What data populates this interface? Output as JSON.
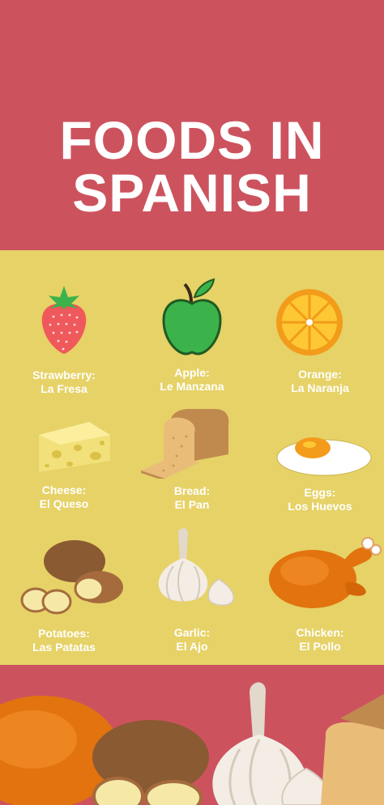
{
  "title": {
    "line1": "FOODS IN",
    "line2": "SPANISH"
  },
  "colors": {
    "header_bg": "#cc535e",
    "panel_bg": "#e6d267",
    "text": "#ffffff"
  },
  "items": [
    {
      "icon": "strawberry-icon",
      "english": "Strawberry:",
      "spanish": "La Fresa"
    },
    {
      "icon": "apple-icon",
      "english": "Apple:",
      "spanish": "Le Manzana"
    },
    {
      "icon": "orange-icon",
      "english": "Orange:",
      "spanish": "La Naranja"
    },
    {
      "icon": "cheese-icon",
      "english": "Cheese:",
      "spanish": "El Queso"
    },
    {
      "icon": "bread-icon",
      "english": "Bread:",
      "spanish": "El Pan"
    },
    {
      "icon": "egg-icon",
      "english": "Eggs:",
      "spanish": "Los Huevos"
    },
    {
      "icon": "potato-icon",
      "english": "Potatoes:",
      "spanish": "Las Patatas"
    },
    {
      "icon": "garlic-icon",
      "english": "Garlic:",
      "spanish": "El Ajo"
    },
    {
      "icon": "chicken-icon",
      "english": "Chicken:",
      "spanish": "El Pollo"
    }
  ]
}
